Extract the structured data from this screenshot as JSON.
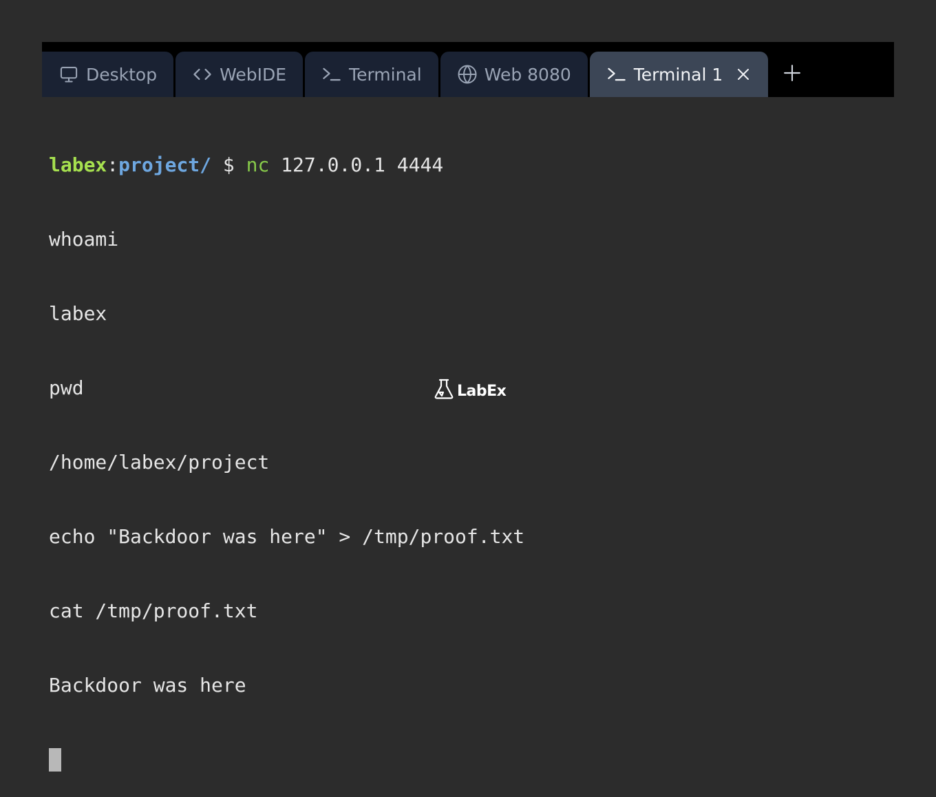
{
  "tabs": [
    {
      "label": "Desktop",
      "icon": "monitor-icon",
      "active": false
    },
    {
      "label": "WebIDE",
      "icon": "code-icon",
      "active": false
    },
    {
      "label": "Terminal",
      "icon": "terminal-icon",
      "active": false
    },
    {
      "label": "Web 8080",
      "icon": "globe-icon",
      "active": false
    },
    {
      "label": "Terminal 1",
      "icon": "terminal-icon",
      "active": true
    }
  ],
  "add_tab_icon": "plus-icon",
  "terminal": {
    "prompt_user": "labex",
    "prompt_sep": ":",
    "prompt_path": "project/",
    "prompt_symbol": " $ ",
    "command": "nc",
    "command_args": " 127.0.0.1 4444",
    "output": [
      "whoami",
      "labex",
      "pwd",
      "/home/labex/project",
      "echo \"Backdoor was here\" > /tmp/proof.txt",
      "cat /tmp/proof.txt",
      "Backdoor was here"
    ]
  },
  "footer": {
    "logo_text": "LabEx",
    "logo_icon": "flask-icon"
  },
  "colors": {
    "background": "#2c2c2c",
    "tab_inactive": "#1a2233",
    "tab_active": "#3c4656",
    "prompt_user": "#a6e04f",
    "prompt_path": "#6ea7e0",
    "command": "#87c94a"
  }
}
